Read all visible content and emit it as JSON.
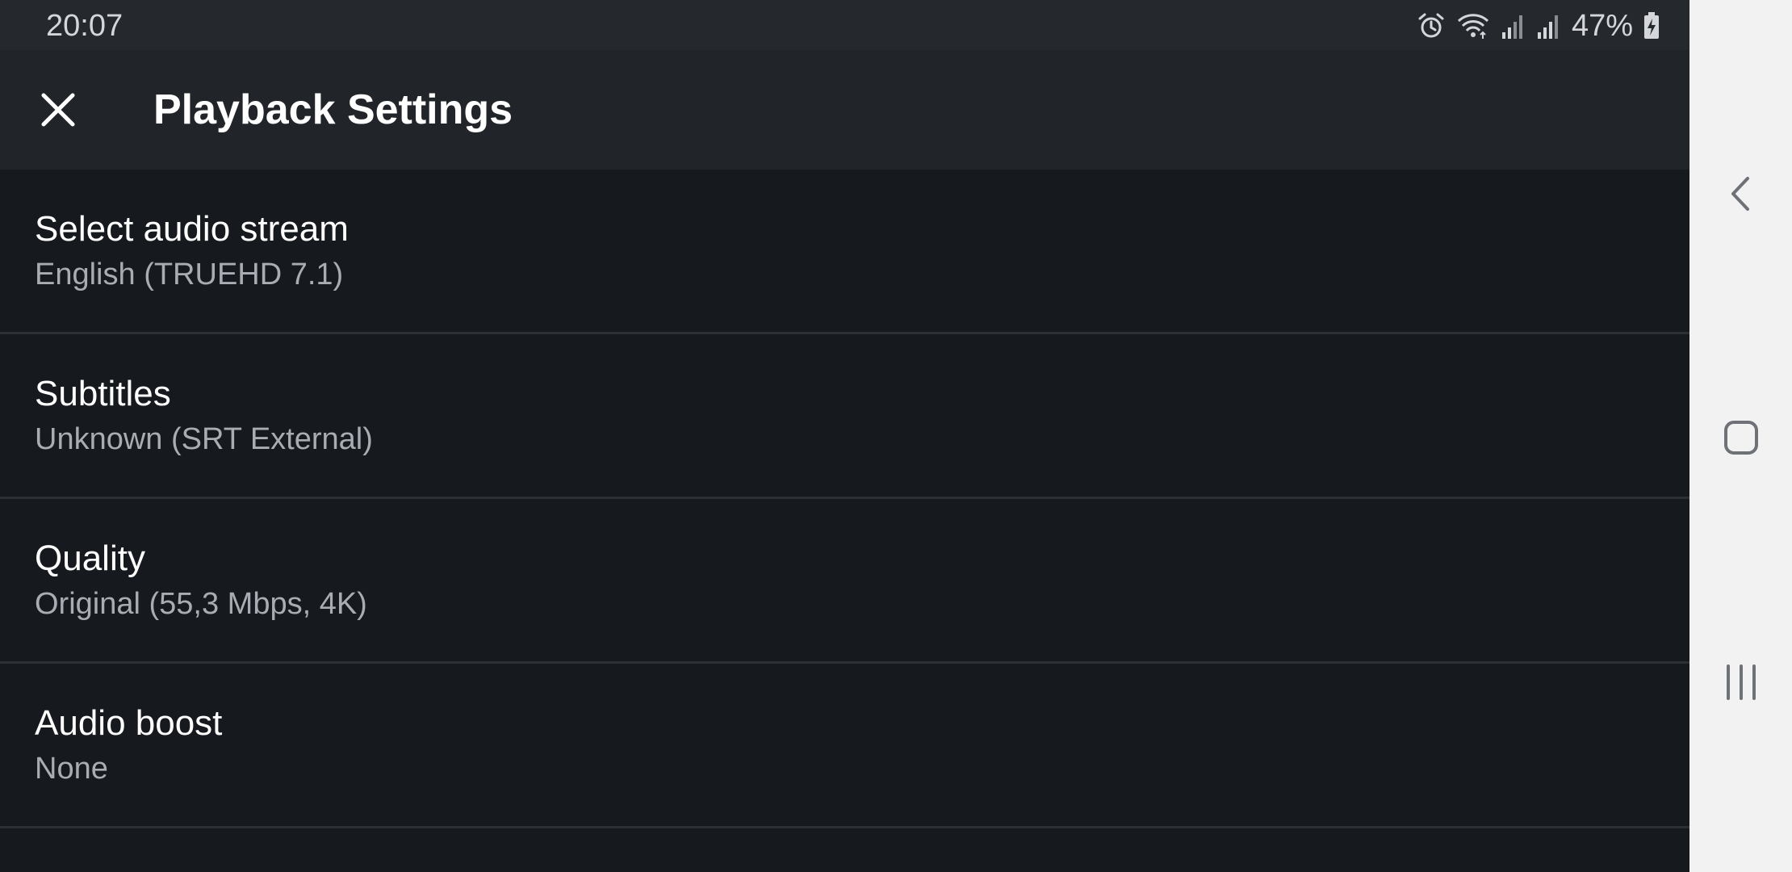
{
  "status_bar": {
    "time": "20:07",
    "battery_percent": "47%",
    "icons": [
      "alarm-icon",
      "wifi-icon",
      "signal-icon",
      "signal-icon",
      "battery-charging-icon"
    ]
  },
  "toolbar": {
    "close_icon": "close-icon",
    "title": "Playback Settings"
  },
  "settings": [
    {
      "title": "Select audio stream",
      "value": "English (TRUEHD 7.1)"
    },
    {
      "title": "Subtitles",
      "value": "Unknown (SRT External)"
    },
    {
      "title": "Quality",
      "value": "Original (55,3 Mbps, 4K)"
    },
    {
      "title": "Audio boost",
      "value": "None"
    }
  ],
  "nav_bar": {
    "buttons": [
      "back-icon",
      "home-icon",
      "recent-apps-icon"
    ]
  },
  "colors": {
    "background": "#16191d",
    "toolbar": "#212429",
    "status_bar": "#25282d",
    "divider": "#2c3035",
    "primary_text": "#ffffff",
    "secondary_text": "#a9adb3",
    "nav_bar": "#f2f2f2"
  }
}
